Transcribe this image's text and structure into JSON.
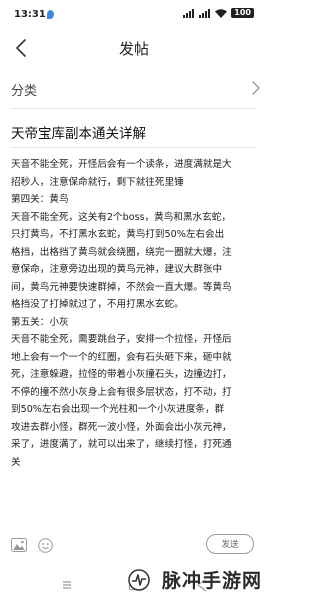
{
  "status_bar": {
    "time": "13:31",
    "battery": "100"
  },
  "nav": {
    "title": "发帖"
  },
  "category": {
    "label": "分类"
  },
  "post": {
    "title": "天帝宝库副本通关详解",
    "lines": [
      "天音不能全死，开怪后会有一个读条，进度满就是大",
      "招秒人，注意保命就行，剩下就往死里锤",
      "第四关：黄鸟",
      "天音不能全死，这关有2个boss，黄鸟和黑水玄蛇，",
      "只打黄鸟，不打黑水玄蛇，黄鸟打到50%左右会出",
      "格挡，出格挡了黄鸟就会绕圈，绕完一圈就大爆，注",
      "意保命，注意旁边出现的黄鸟元神，建议大群张中",
      "间，黄鸟元神要快速群掉，不然会一直大爆。等黄鸟",
      "格挡没了打掉就过了，不用打黑水玄蛇。",
      "第五关：小灰",
      "天音不能全死，需要跳台子，安排一个拉怪，开怪后",
      "地上会有一个一个的红圈，会有石头砸下来，砸中就",
      "死，注意躲避，拉怪的带着小灰撞石头，边撞边打，",
      "不停的撞不然小灰身上会有很多层状态，打不动，打",
      "到50%左右会出现一个光柱和一个小灰进度条，群",
      "攻进去群小怪，群死一波小怪，外面会出小灰元神，",
      "采了，进度满了，就可以出来了，继续打怪，打死通",
      "关"
    ]
  },
  "toolbar": {
    "send_label": "发送",
    "image_icon": "image-icon",
    "emoji_icon": "emoji-icon"
  },
  "watermark": {
    "text": "脉冲手游网"
  }
}
